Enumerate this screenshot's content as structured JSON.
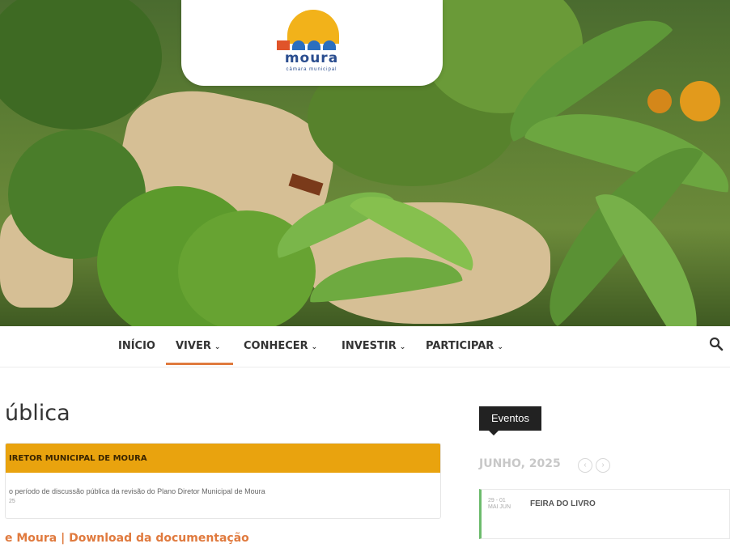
{
  "logo": {
    "name": "moura",
    "subtitle": "câmara municipal"
  },
  "nav": {
    "items": [
      {
        "label": "INÍCIO",
        "dropdown": false
      },
      {
        "label": "VIVER",
        "dropdown": true,
        "active": true
      },
      {
        "label": "CONHECER",
        "dropdown": true
      },
      {
        "label": "INVESTIR",
        "dropdown": true
      },
      {
        "label": "PARTICIPAR",
        "dropdown": true
      }
    ],
    "search_icon": "search-icon"
  },
  "page": {
    "title": "ública",
    "notice": {
      "title": "IRETOR MUNICIPAL DE MOURA",
      "text": "o período de discussão pública da revisão do Plano Diretor Municipal de Moura",
      "date": "25"
    },
    "download_link": "e Moura | Download da documentação"
  },
  "sidebar": {
    "events_label": "Eventos",
    "month": "JUNHO, 2025",
    "event": {
      "date_start": "29",
      "month_start": "MAI",
      "date_end": "01",
      "month_end": "JUN",
      "title": "FEIRA DO LIVRO"
    }
  },
  "colors": {
    "accent": "#e07a3e",
    "notice_header": "#e9a30e",
    "event_border": "#6dbb6d",
    "logo_sun": "#f2b21a",
    "logo_blue": "#2a4d8f"
  }
}
